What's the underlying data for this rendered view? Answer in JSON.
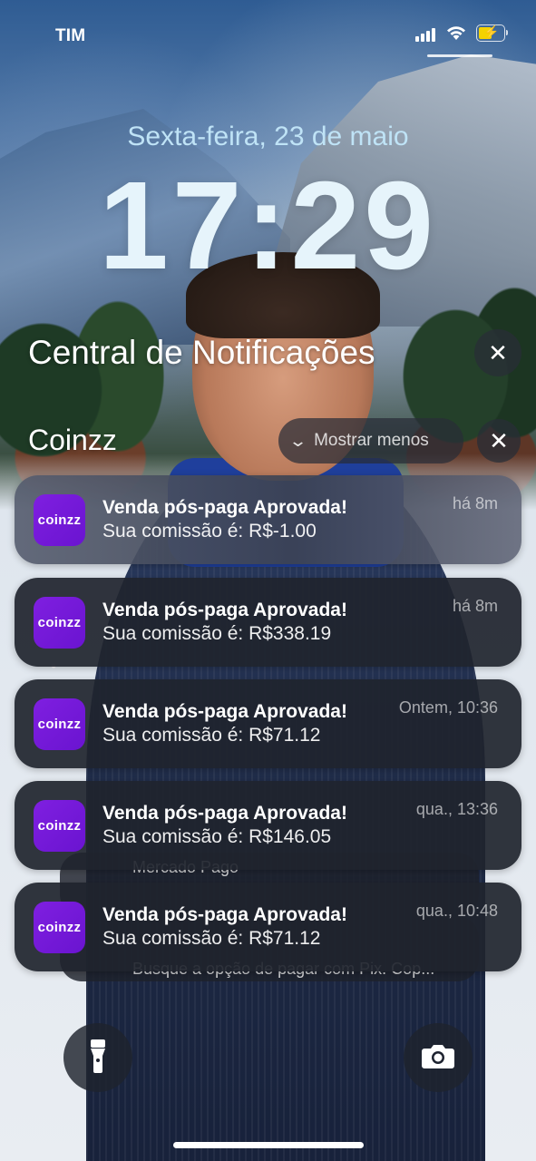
{
  "status_bar": {
    "carrier": "TIM"
  },
  "lock_screen": {
    "date": "Sexta-feira, 23 de maio",
    "time": "17:29"
  },
  "notification_center": {
    "title": "Central de Notificações",
    "group": {
      "app_name": "Coinzz",
      "show_less_label": "Mostrar menos",
      "app_icon_text": "coinzz",
      "app_icon_color": "#7418dd"
    },
    "notifications": [
      {
        "title": "Venda pós-paga Aprovada!",
        "body": "Sua comissão é: R$-1.00",
        "time": "há 8m"
      },
      {
        "title": "Venda pós-paga Aprovada!",
        "body": "Sua comissão é: R$338.19",
        "time": "há 8m"
      },
      {
        "title": "Venda pós-paga Aprovada!",
        "body": "Sua comissão é: R$71.12",
        "time": "Ontem, 10:36"
      },
      {
        "title": "Venda pós-paga Aprovada!",
        "body": "Sua comissão é: R$146.05",
        "time": "qua., 13:36"
      },
      {
        "title": "Venda pós-paga Aprovada!",
        "body": "Sua comissão é: R$71.12",
        "time": "qua., 10:48"
      }
    ],
    "background_stack": {
      "peek_title": "Mercado Pago",
      "peek_body": "Busque a opção de pagar com Pix. Cop..."
    }
  },
  "bottom_controls": {
    "left": "flashlight-icon",
    "right": "camera-icon"
  }
}
